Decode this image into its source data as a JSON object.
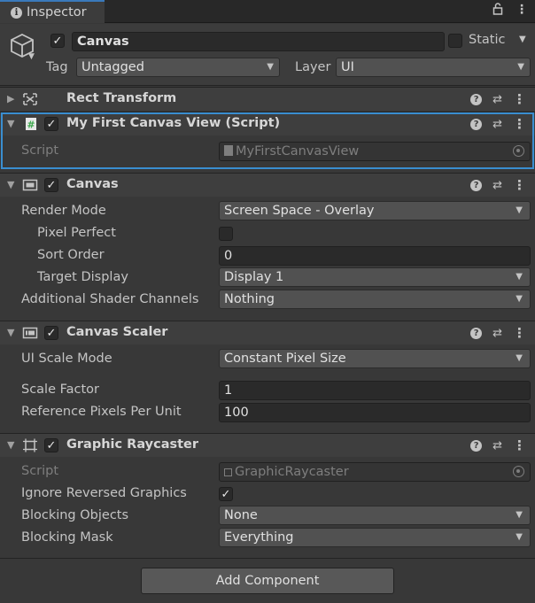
{
  "tab": {
    "title": "Inspector",
    "lock": "lock-icon",
    "menu": "kebab-menu-icon"
  },
  "header": {
    "name": "Canvas",
    "static_label": "Static",
    "tag_label": "Tag",
    "tag_value": "Untagged",
    "layer_label": "Layer",
    "layer_value": "UI"
  },
  "components": {
    "rect_transform": {
      "title": "Rect Transform"
    },
    "my_first_canvas_view": {
      "title": "My First Canvas View (Script)",
      "script_label": "Script",
      "script_value": "MyFirstCanvasView"
    },
    "canvas": {
      "title": "Canvas",
      "render_mode_label": "Render Mode",
      "render_mode_value": "Screen Space - Overlay",
      "pixel_perfect_label": "Pixel Perfect",
      "pixel_perfect_checked": false,
      "sort_order_label": "Sort Order",
      "sort_order_value": "0",
      "target_display_label": "Target Display",
      "target_display_value": "Display 1",
      "shader_channels_label": "Additional Shader Channels",
      "shader_channels_value": "Nothing"
    },
    "canvas_scaler": {
      "title": "Canvas Scaler",
      "ui_scale_mode_label": "UI Scale Mode",
      "ui_scale_mode_value": "Constant Pixel Size",
      "scale_factor_label": "Scale Factor",
      "scale_factor_value": "1",
      "ref_ppu_label": "Reference Pixels Per Unit",
      "ref_ppu_value": "100"
    },
    "graphic_raycaster": {
      "title": "Graphic Raycaster",
      "script_label": "Script",
      "script_value": "GraphicRaycaster",
      "ignore_reversed_label": "Ignore Reversed Graphics",
      "ignore_reversed_checked": true,
      "blocking_objects_label": "Blocking Objects",
      "blocking_objects_value": "None",
      "blocking_mask_label": "Blocking Mask",
      "blocking_mask_value": "Everything"
    }
  },
  "add_component_label": "Add Component",
  "colors": {
    "selection": "#3a8ed0",
    "panel": "#383838",
    "field": "#2a2a2a",
    "dropdown": "#515151"
  }
}
